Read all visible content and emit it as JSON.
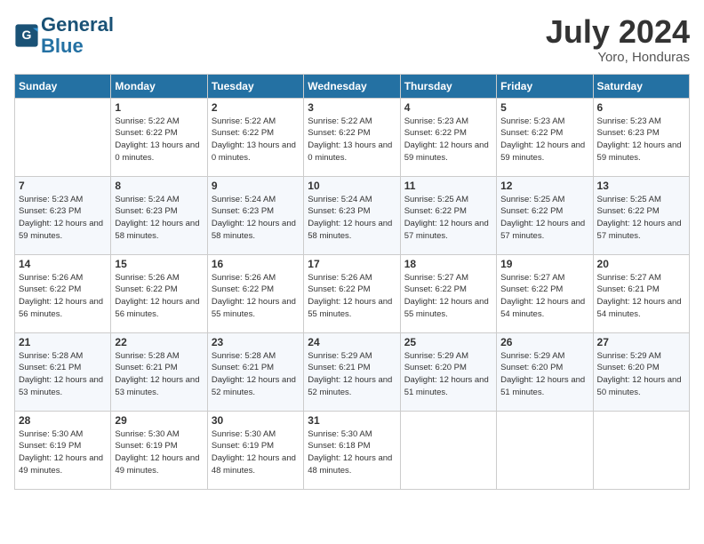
{
  "header": {
    "logo_line1": "General",
    "logo_line2": "Blue",
    "month_year": "July 2024",
    "location": "Yoro, Honduras"
  },
  "days_of_week": [
    "Sunday",
    "Monday",
    "Tuesday",
    "Wednesday",
    "Thursday",
    "Friday",
    "Saturday"
  ],
  "weeks": [
    [
      {
        "day": "",
        "info": ""
      },
      {
        "day": "1",
        "info": "Sunrise: 5:22 AM\nSunset: 6:22 PM\nDaylight: 13 hours\nand 0 minutes."
      },
      {
        "day": "2",
        "info": "Sunrise: 5:22 AM\nSunset: 6:22 PM\nDaylight: 13 hours\nand 0 minutes."
      },
      {
        "day": "3",
        "info": "Sunrise: 5:22 AM\nSunset: 6:22 PM\nDaylight: 13 hours\nand 0 minutes."
      },
      {
        "day": "4",
        "info": "Sunrise: 5:23 AM\nSunset: 6:22 PM\nDaylight: 12 hours\nand 59 minutes."
      },
      {
        "day": "5",
        "info": "Sunrise: 5:23 AM\nSunset: 6:22 PM\nDaylight: 12 hours\nand 59 minutes."
      },
      {
        "day": "6",
        "info": "Sunrise: 5:23 AM\nSunset: 6:23 PM\nDaylight: 12 hours\nand 59 minutes."
      }
    ],
    [
      {
        "day": "7",
        "info": "Sunrise: 5:23 AM\nSunset: 6:23 PM\nDaylight: 12 hours\nand 59 minutes."
      },
      {
        "day": "8",
        "info": "Sunrise: 5:24 AM\nSunset: 6:23 PM\nDaylight: 12 hours\nand 58 minutes."
      },
      {
        "day": "9",
        "info": "Sunrise: 5:24 AM\nSunset: 6:23 PM\nDaylight: 12 hours\nand 58 minutes."
      },
      {
        "day": "10",
        "info": "Sunrise: 5:24 AM\nSunset: 6:23 PM\nDaylight: 12 hours\nand 58 minutes."
      },
      {
        "day": "11",
        "info": "Sunrise: 5:25 AM\nSunset: 6:22 PM\nDaylight: 12 hours\nand 57 minutes."
      },
      {
        "day": "12",
        "info": "Sunrise: 5:25 AM\nSunset: 6:22 PM\nDaylight: 12 hours\nand 57 minutes."
      },
      {
        "day": "13",
        "info": "Sunrise: 5:25 AM\nSunset: 6:22 PM\nDaylight: 12 hours\nand 57 minutes."
      }
    ],
    [
      {
        "day": "14",
        "info": "Sunrise: 5:26 AM\nSunset: 6:22 PM\nDaylight: 12 hours\nand 56 minutes."
      },
      {
        "day": "15",
        "info": "Sunrise: 5:26 AM\nSunset: 6:22 PM\nDaylight: 12 hours\nand 56 minutes."
      },
      {
        "day": "16",
        "info": "Sunrise: 5:26 AM\nSunset: 6:22 PM\nDaylight: 12 hours\nand 55 minutes."
      },
      {
        "day": "17",
        "info": "Sunrise: 5:26 AM\nSunset: 6:22 PM\nDaylight: 12 hours\nand 55 minutes."
      },
      {
        "day": "18",
        "info": "Sunrise: 5:27 AM\nSunset: 6:22 PM\nDaylight: 12 hours\nand 55 minutes."
      },
      {
        "day": "19",
        "info": "Sunrise: 5:27 AM\nSunset: 6:22 PM\nDaylight: 12 hours\nand 54 minutes."
      },
      {
        "day": "20",
        "info": "Sunrise: 5:27 AM\nSunset: 6:21 PM\nDaylight: 12 hours\nand 54 minutes."
      }
    ],
    [
      {
        "day": "21",
        "info": "Sunrise: 5:28 AM\nSunset: 6:21 PM\nDaylight: 12 hours\nand 53 minutes."
      },
      {
        "day": "22",
        "info": "Sunrise: 5:28 AM\nSunset: 6:21 PM\nDaylight: 12 hours\nand 53 minutes."
      },
      {
        "day": "23",
        "info": "Sunrise: 5:28 AM\nSunset: 6:21 PM\nDaylight: 12 hours\nand 52 minutes."
      },
      {
        "day": "24",
        "info": "Sunrise: 5:29 AM\nSunset: 6:21 PM\nDaylight: 12 hours\nand 52 minutes."
      },
      {
        "day": "25",
        "info": "Sunrise: 5:29 AM\nSunset: 6:20 PM\nDaylight: 12 hours\nand 51 minutes."
      },
      {
        "day": "26",
        "info": "Sunrise: 5:29 AM\nSunset: 6:20 PM\nDaylight: 12 hours\nand 51 minutes."
      },
      {
        "day": "27",
        "info": "Sunrise: 5:29 AM\nSunset: 6:20 PM\nDaylight: 12 hours\nand 50 minutes."
      }
    ],
    [
      {
        "day": "28",
        "info": "Sunrise: 5:30 AM\nSunset: 6:19 PM\nDaylight: 12 hours\nand 49 minutes."
      },
      {
        "day": "29",
        "info": "Sunrise: 5:30 AM\nSunset: 6:19 PM\nDaylight: 12 hours\nand 49 minutes."
      },
      {
        "day": "30",
        "info": "Sunrise: 5:30 AM\nSunset: 6:19 PM\nDaylight: 12 hours\nand 48 minutes."
      },
      {
        "day": "31",
        "info": "Sunrise: 5:30 AM\nSunset: 6:18 PM\nDaylight: 12 hours\nand 48 minutes."
      },
      {
        "day": "",
        "info": ""
      },
      {
        "day": "",
        "info": ""
      },
      {
        "day": "",
        "info": ""
      }
    ]
  ]
}
